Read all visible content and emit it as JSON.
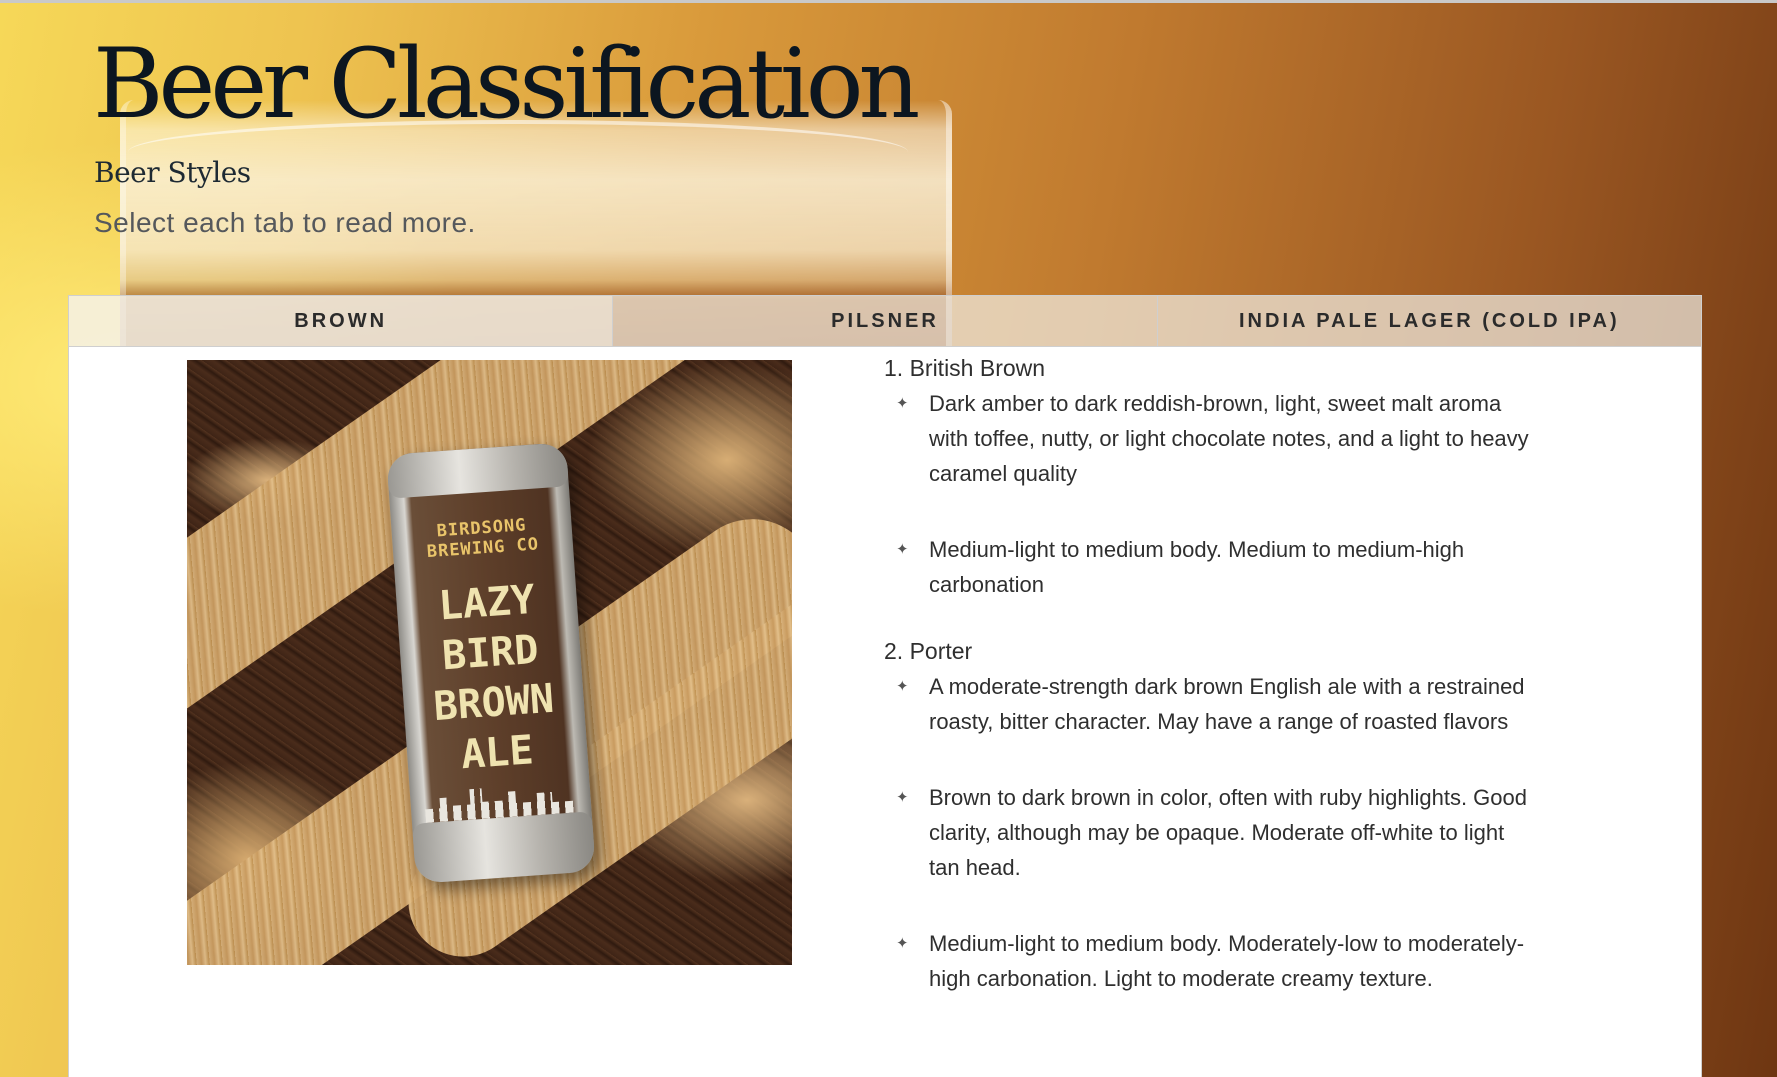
{
  "header": {
    "title": "Beer Classification",
    "subtitle": "Beer Styles",
    "instructions": "Select each tab to read more."
  },
  "tabs": [
    {
      "label": "BROWN",
      "active": true
    },
    {
      "label": "PILSNER",
      "active": false
    },
    {
      "label": "INDIA PALE LAGER (COLD IPA)",
      "active": false
    }
  ],
  "panel": {
    "image": {
      "alt_semantic": "brown ale can on malt grains",
      "can_brand": "BIRDSONG BREWING CO",
      "can_name": "LAZY BIRD BROWN ALE"
    },
    "bullet_icon": "four-point-star-bullet",
    "styles": [
      {
        "name": "1. British Brown",
        "points": [
          "Dark amber to dark reddish-brown, light, sweet malt aroma with toffee, nutty, or light chocolate notes, and a light to heavy caramel quality",
          "Medium-light to medium body. Medium to medium-high carbonation"
        ]
      },
      {
        "name": "2. Porter",
        "points": [
          "A moderate-strength dark brown English ale with a restrained roasty, bitter character. May have a range of roasted flavors",
          "Brown to dark brown in color, often with ruby highlights. Good clarity, although may be opaque. Moderate off-white to light tan head.",
          "Medium-light to medium body. Moderately-low to moderately-high carbonation. Light to moderate creamy texture."
        ]
      }
    ]
  },
  "colors": {
    "title": "#0c1620",
    "tab_bg": "#f0ece2",
    "panel_bg": "#ffffff",
    "text": "#2f2f2f",
    "background_gold": "#eec350",
    "background_brown": "#6e3612"
  }
}
